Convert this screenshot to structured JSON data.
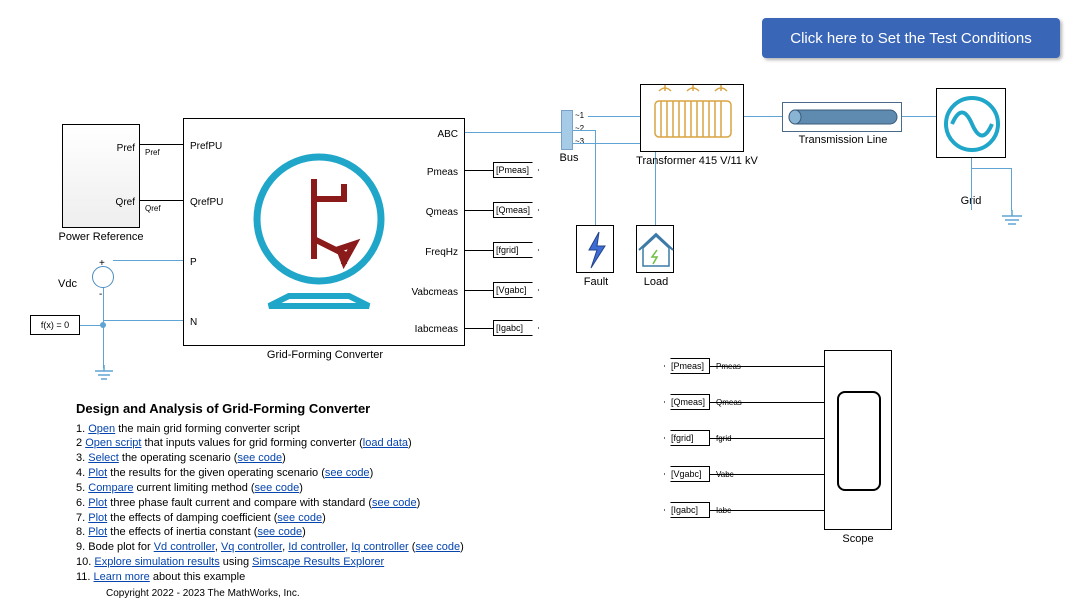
{
  "banner": {
    "text": "Click here to Set the Test Conditions"
  },
  "powerRef": {
    "title": "Power Reference",
    "port1": "Pref",
    "port2": "Qref"
  },
  "converter": {
    "title": "Grid-Forming Converter",
    "in_pref": "PrefPU",
    "in_qref": "QrefPU",
    "in_prefSmall": "Pref",
    "in_qrefSmall": "Qref",
    "p": "P",
    "n": "N",
    "outputs": {
      "abc": "ABC",
      "pmeas": "Pmeas",
      "qmeas": "Qmeas",
      "freq": "FreqHz",
      "vabc": "Vabcmeas",
      "iabc": "Iabcmeas"
    }
  },
  "tags": {
    "pmeas": "[Pmeas]",
    "qmeas": "[Qmeas]",
    "fgrid": "[fgrid]",
    "vgabc": "[Vgabc]",
    "igabc": "[Igabc]"
  },
  "scopeTags": {
    "pmeas": "[Pmeas]",
    "qmeas": "[Qmeas]",
    "fgrid": "[fgrid]",
    "vgabc": "[Vgabc]",
    "igabc": "[Igabc]"
  },
  "scopeLabels": {
    "pmeas": "Pmeas",
    "qmeas": "Qmeas",
    "fgrid": "fgrid",
    "vabc": "Vabc",
    "iabc": "Iabc"
  },
  "vdc": "Vdc",
  "fx": "f(x) = 0",
  "bus": {
    "label": "Bus",
    "ports": {
      "p1": "~1",
      "p2": "~2",
      "p3": "~3"
    }
  },
  "xfmr": "Transformer 415 V/11 kV",
  "tline": "Transmission Line",
  "grid": "Grid",
  "fault": "Fault",
  "load": "Load",
  "scope": "Scope",
  "instructions": {
    "title": "Design and Analysis of Grid-Forming Converter",
    "items": [
      {
        "n": "1.",
        "link1": "Open",
        "text": " the main grid forming converter script"
      },
      {
        "n": "2",
        "link1": "Open script",
        "text": " that inputs values for grid forming converter (",
        "link2": "load data",
        "text2": ")"
      },
      {
        "n": "3.",
        "link1": "Select",
        "text": " the operating scenario (",
        "link2": "see code",
        "text2": ")"
      },
      {
        "n": "4.",
        "link1": "Plot",
        "text": " the results for the given operating scenario (",
        "link2": "see code",
        "text2": ")"
      },
      {
        "n": "5.",
        "link1": "Compare",
        "text": " current limiting method (",
        "link2": "see code",
        "text2": ")"
      },
      {
        "n": "6.",
        "link1": "Plot",
        "text": " three phase fault current and compare with standard (",
        "link2": "see code",
        "text2": ")"
      },
      {
        "n": "7.",
        "link1": "Plot",
        "text": " the effects of damping coefficient (",
        "link2": "see code",
        "text2": ")"
      },
      {
        "n": "8.",
        "link1": "Plot",
        "text": " the effects of inertia constant  (",
        "link2": "see code",
        "text2": ")"
      },
      {
        "n": "9.",
        "text0": "Bode plot for ",
        "link1": "Vd controller",
        "text": ", ",
        "link2": "Vq controller",
        "text2": ", ",
        "link3": "Id controller",
        "text3": ", ",
        "link4": "Iq controller",
        "text4": " (",
        "link5": "see code",
        "text5": ")"
      },
      {
        "n": "10.",
        "link1": "Explore simulation results",
        "text": " using ",
        "link2": "Simscape Results Explorer"
      },
      {
        "n": "11.",
        "link1": "Learn more",
        "text": " about this example"
      }
    ],
    "copyright": "Copyright 2022 - 2023 The MathWorks, Inc."
  }
}
